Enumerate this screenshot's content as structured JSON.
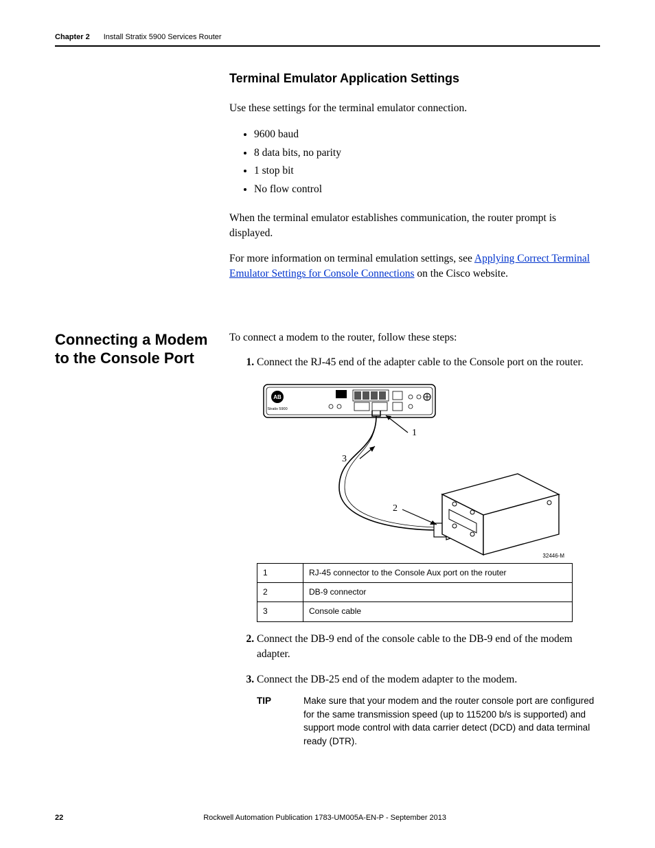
{
  "header": {
    "chapter_label": "Chapter 2",
    "chapter_title": "Install Stratix 5900 Services Router"
  },
  "section1": {
    "subheading": "Terminal Emulator Application Settings",
    "intro": "Use these settings for the terminal emulator connection.",
    "bullets": [
      "9600 baud",
      "8 data bits, no parity",
      "1 stop bit",
      "No flow control"
    ],
    "para2": "When the terminal emulator establishes communication, the router prompt is displayed.",
    "para3_pre": "For more information on terminal emulation settings, see ",
    "link_text": "Applying Correct Terminal Emulator Settings for Console Connections",
    "para3_post": " on the Cisco website."
  },
  "section2": {
    "heading": "Connecting a Modem to the Console Port",
    "intro": "To connect a modem to the router, follow these steps:",
    "steps": {
      "s1": "Connect the RJ-45 end of the adapter cable to the Console port on the router.",
      "s2": "Connect the DB-9 end of the console cable to the DB-9 end of the modem adapter.",
      "s3": "Connect the DB-25 end of the modem adapter to the modem."
    },
    "figure": {
      "device_brand": "AB",
      "device_model": "Stratix 5900",
      "id": "32446-M",
      "callouts": {
        "c1": "1",
        "c2": "2",
        "c3": "3"
      }
    },
    "legend": [
      {
        "num": "1",
        "text": "RJ-45 connector to the Console Aux port on the router"
      },
      {
        "num": "2",
        "text": "DB-9 connector"
      },
      {
        "num": "3",
        "text": "Console cable"
      }
    ],
    "tip_label": "TIP",
    "tip_text": "Make sure that your modem and the router console port are configured for the same transmission speed (up to 115200 b/s is supported) and support mode control with data carrier detect (DCD) and data terminal ready (DTR)."
  },
  "footer": {
    "page_number": "22",
    "publication": "Rockwell Automation Publication 1783-UM005A-EN-P - September 2013"
  }
}
